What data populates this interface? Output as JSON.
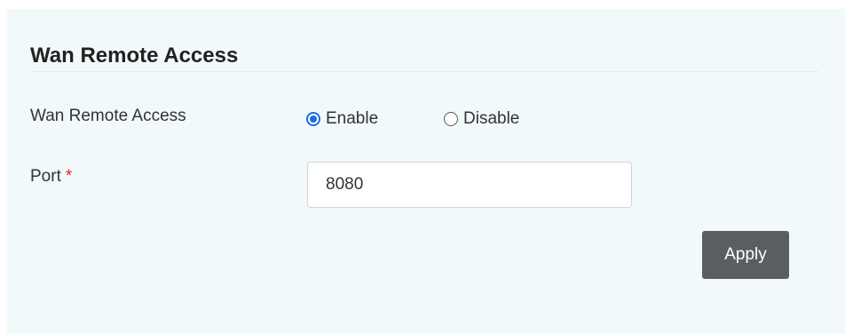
{
  "section": {
    "title": "Wan Remote Access"
  },
  "wan_remote_access": {
    "label": "Wan Remote Access",
    "options": [
      {
        "label": "Enable",
        "selected": true
      },
      {
        "label": "Disable",
        "selected": false
      }
    ]
  },
  "port": {
    "label": "Port",
    "required_marker": "*",
    "value": "8080"
  },
  "actions": {
    "apply_label": "Apply"
  },
  "colors": {
    "panel_background": "#f1f9fb",
    "radio_selected": "#1a6fe0",
    "required_marker": "#e0262b",
    "apply_button": "#5a5e62"
  }
}
